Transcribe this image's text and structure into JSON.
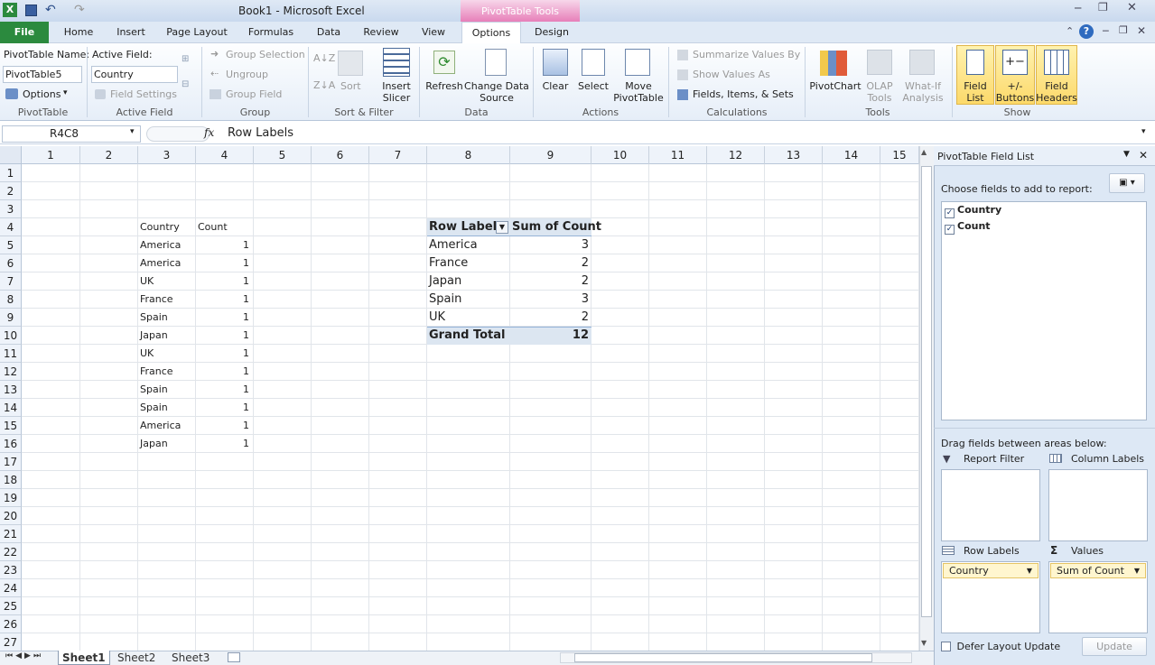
{
  "window": {
    "title": "Book1 - Microsoft Excel",
    "context_tab_header": "PivotTable Tools"
  },
  "tabs": [
    "File",
    "Home",
    "Insert",
    "Page Layout",
    "Formulas",
    "Data",
    "Review",
    "View",
    "Options",
    "Design"
  ],
  "ribbon": {
    "pivottable": {
      "name_label": "PivotTable Name:",
      "name_value": "PivotTable5",
      "options": "Options",
      "group": "PivotTable"
    },
    "active_field": {
      "label": "Active Field:",
      "value": "Country",
      "field_settings": "Field Settings",
      "group": "Active Field"
    },
    "group": {
      "group_selection": "Group Selection",
      "ungroup": "Ungroup",
      "group_field": "Group Field",
      "group": "Group"
    },
    "sort": {
      "sort": "Sort",
      "insert_slicer": "Insert\nSlicer",
      "group": "Sort & Filter"
    },
    "data": {
      "refresh": "Refresh",
      "change_source": "Change Data\nSource",
      "group": "Data"
    },
    "actions": {
      "clear": "Clear",
      "select": "Select",
      "move": "Move\nPivotTable",
      "group": "Actions"
    },
    "calculations": {
      "summarize": "Summarize Values By",
      "show_values": "Show Values As",
      "fields_items": "Fields, Items, & Sets",
      "group": "Calculations"
    },
    "tools": {
      "pivotchart": "PivotChart",
      "olap": "OLAP\nTools",
      "whatif": "What-If\nAnalysis",
      "group": "Tools"
    },
    "show": {
      "field_list": "Field\nList",
      "buttons": "+/-\nButtons",
      "headers": "Field\nHeaders",
      "group": "Show"
    }
  },
  "formula_bar": {
    "name_box": "R4C8",
    "fx": "fx",
    "formula": "Row Labels"
  },
  "columns": [
    "1",
    "2",
    "3",
    "4",
    "5",
    "6",
    "7",
    "8",
    "9",
    "10",
    "11",
    "12",
    "13",
    "14",
    "15"
  ],
  "rows": [
    "1",
    "2",
    "3",
    "4",
    "5",
    "6",
    "7",
    "8",
    "9",
    "10",
    "11",
    "12",
    "13",
    "14",
    "15",
    "16",
    "17",
    "18",
    "19",
    "20",
    "21",
    "22",
    "23",
    "24",
    "25",
    "26",
    "27"
  ],
  "source": {
    "header": [
      "Country",
      "Count"
    ],
    "rows": [
      [
        "America",
        "1"
      ],
      [
        "America",
        "1"
      ],
      [
        "UK",
        "1"
      ],
      [
        "France",
        "1"
      ],
      [
        "Spain",
        "1"
      ],
      [
        "Japan",
        "1"
      ],
      [
        "UK",
        "1"
      ],
      [
        "France",
        "1"
      ],
      [
        "Spain",
        "1"
      ],
      [
        "Spain",
        "1"
      ],
      [
        "America",
        "1"
      ],
      [
        "Japan",
        "1"
      ]
    ]
  },
  "pivot": {
    "header": [
      "Row Labels",
      "Sum of Count"
    ],
    "rows": [
      [
        "America",
        "3"
      ],
      [
        "France",
        "2"
      ],
      [
        "Japan",
        "2"
      ],
      [
        "Spain",
        "3"
      ],
      [
        "UK",
        "2"
      ]
    ],
    "total": [
      "Grand Total",
      "12"
    ]
  },
  "sheets": [
    "Sheet1",
    "Sheet2",
    "Sheet3"
  ],
  "field_list": {
    "title": "PivotTable Field List",
    "choose": "Choose fields to add to report:",
    "fields": [
      "Country",
      "Count"
    ],
    "drag": "Drag fields between areas below:",
    "report_filter": "Report Filter",
    "column_labels": "Column Labels",
    "row_labels": "Row Labels",
    "values": "Values",
    "row_pill": "Country",
    "values_pill": "Sum of Count",
    "defer": "Defer Layout Update",
    "update": "Update"
  }
}
